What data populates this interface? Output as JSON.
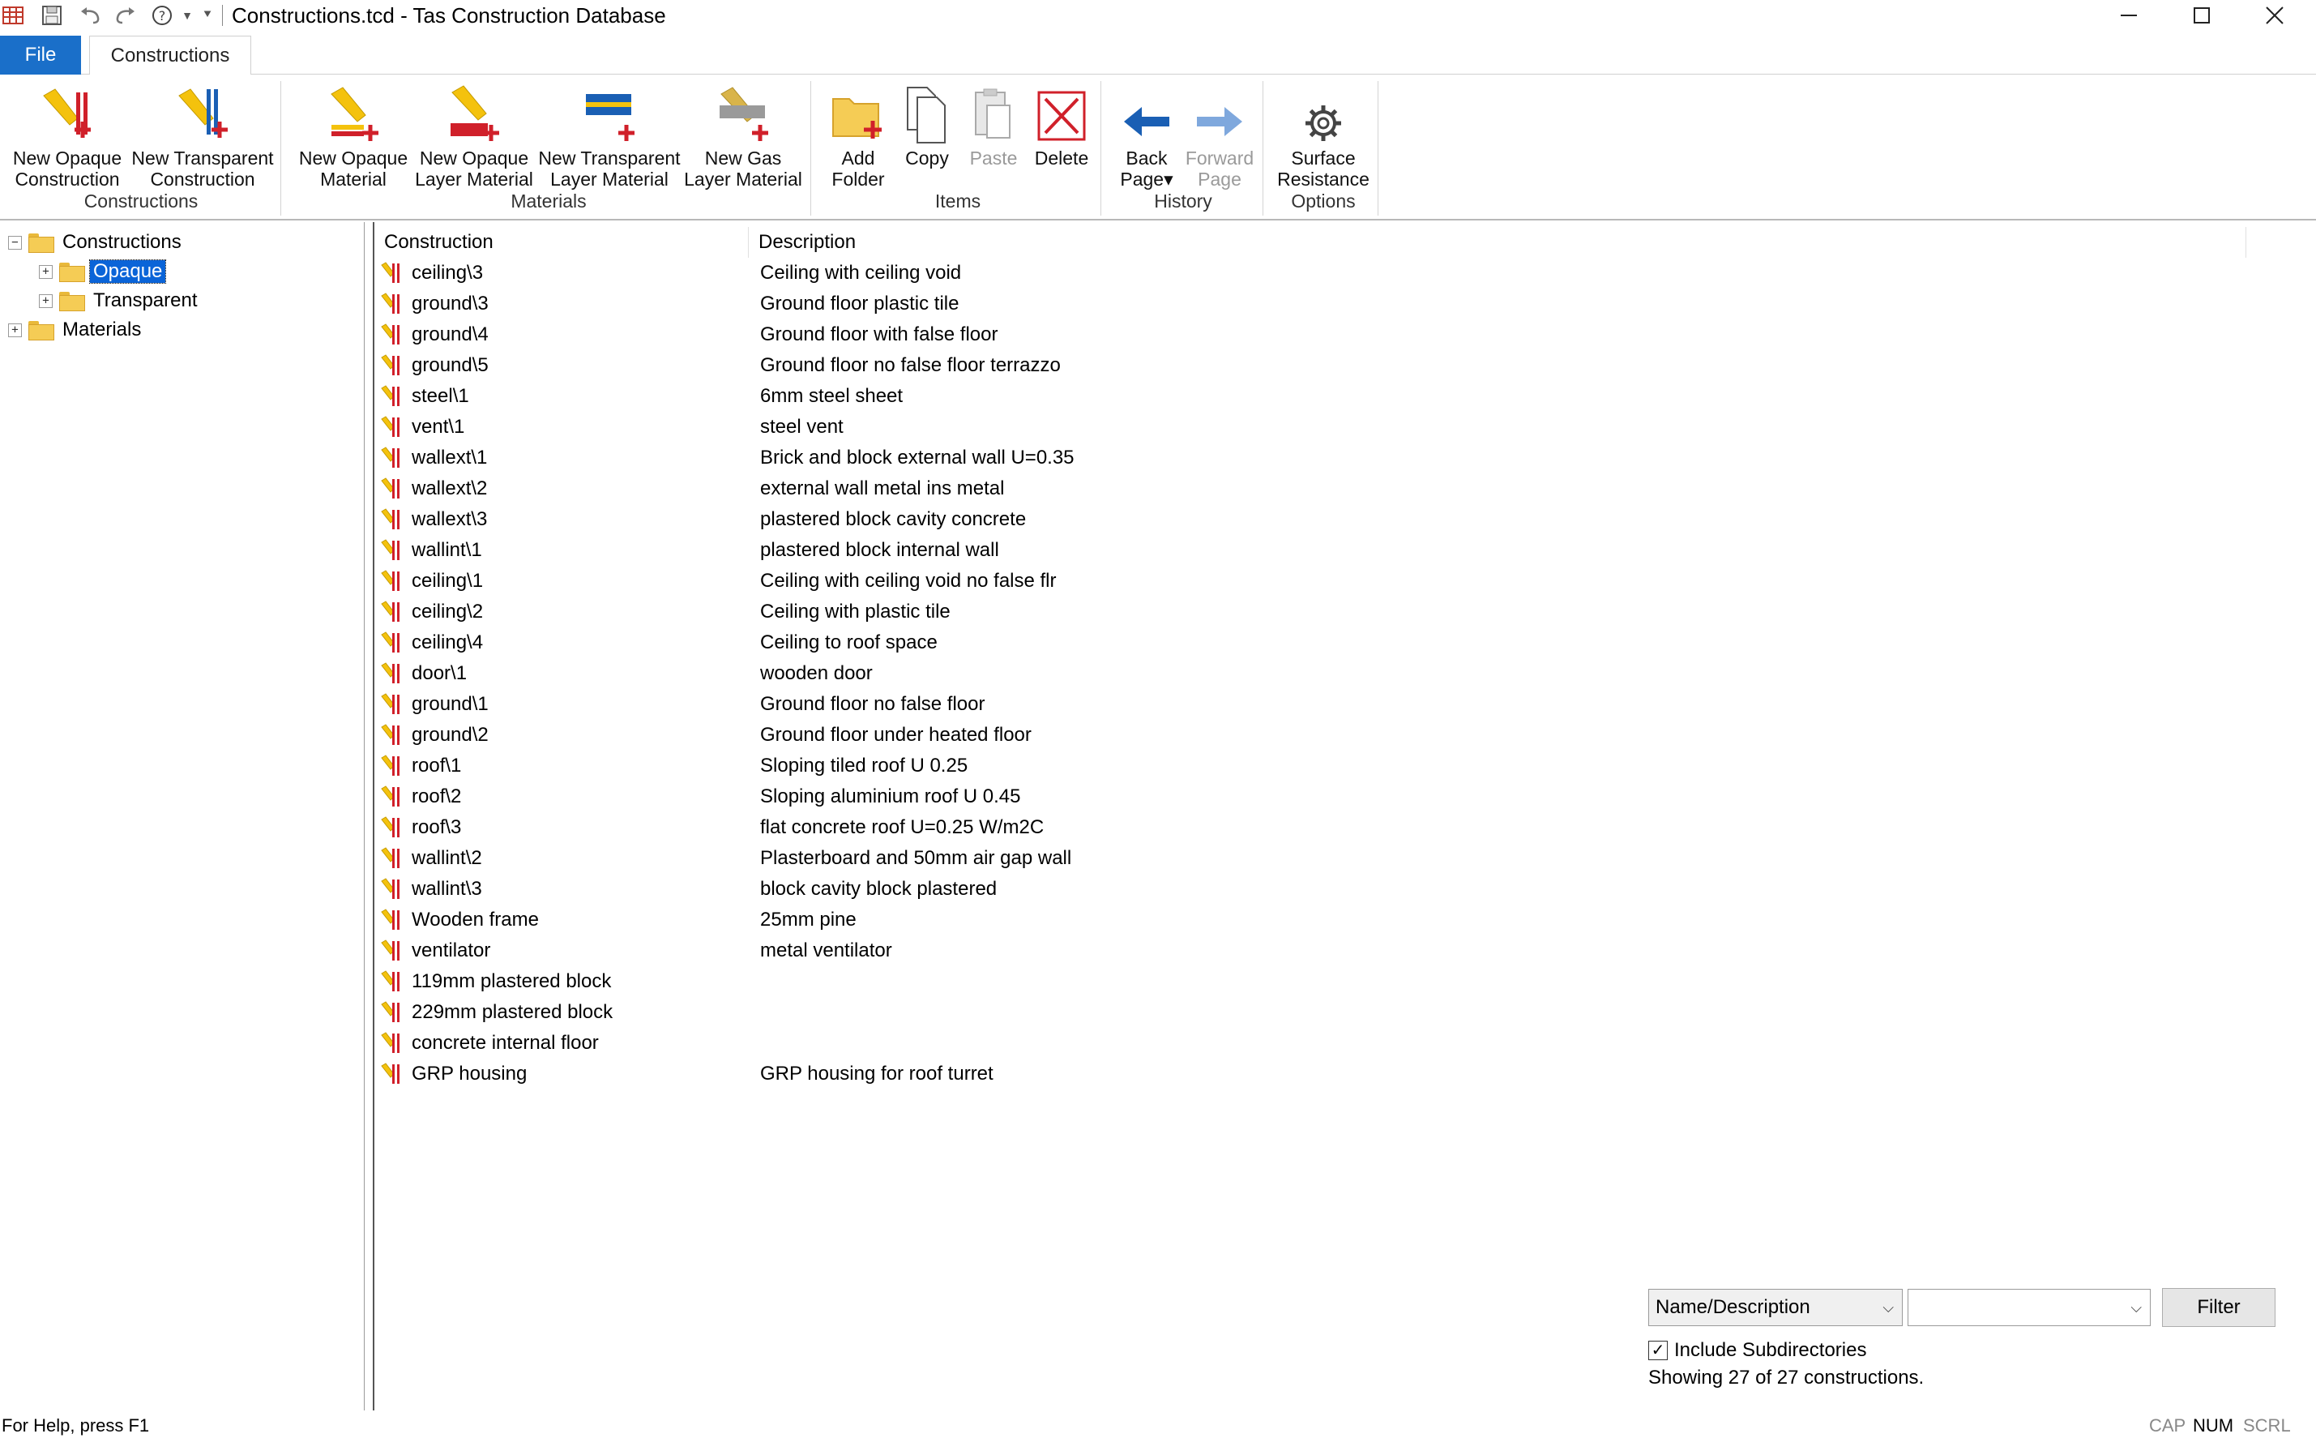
{
  "window": {
    "title": "Constructions.tcd - Tas Construction Database",
    "quick_access": [
      "save-icon",
      "undo-icon",
      "redo-icon",
      "help-icon",
      "customize-icon"
    ]
  },
  "tabs": {
    "file": "File",
    "constructions": "Constructions"
  },
  "ribbon": {
    "groups": {
      "constructions": "Constructions",
      "materials": "Materials",
      "items": "Items",
      "history": "History",
      "options": "Options"
    },
    "buttons": {
      "new_opaque_construction": [
        "New Opaque",
        "Construction"
      ],
      "new_transparent_construction": [
        "New Transparent",
        "Construction"
      ],
      "new_opaque_material": [
        "New Opaque",
        "Material"
      ],
      "new_opaque_layer_material": [
        "New Opaque",
        "Layer Material"
      ],
      "new_transparent_layer_material": [
        "New Transparent",
        "Layer Material"
      ],
      "new_gas_layer_material": [
        "New Gas",
        "Layer Material"
      ],
      "add_folder": [
        "Add",
        "Folder"
      ],
      "copy": [
        "Copy",
        ""
      ],
      "paste": [
        "Paste",
        ""
      ],
      "delete": [
        "Delete",
        ""
      ],
      "back_page": [
        "Back",
        "Page▾"
      ],
      "forward_page": [
        "Forward",
        "Page"
      ],
      "surface_resistance": [
        "Surface",
        "Resistance"
      ]
    }
  },
  "tree": {
    "root": "Constructions",
    "children": [
      "Opaque",
      "Transparent"
    ],
    "materials": "Materials",
    "selected": "Opaque"
  },
  "list": {
    "headers": {
      "construction": "Construction",
      "description": "Description"
    },
    "rows": [
      {
        "name": "ceiling\\3",
        "desc": "Ceiling with ceiling void"
      },
      {
        "name": "ground\\3",
        "desc": "Ground floor plastic tile"
      },
      {
        "name": "ground\\4",
        "desc": "Ground floor with false floor"
      },
      {
        "name": "ground\\5",
        "desc": "Ground floor no false floor terrazzo"
      },
      {
        "name": "steel\\1",
        "desc": "6mm steel sheet"
      },
      {
        "name": "vent\\1",
        "desc": "steel vent"
      },
      {
        "name": "wallext\\1",
        "desc": "Brick and block external wall U=0.35"
      },
      {
        "name": "wallext\\2",
        "desc": "external wall metal ins metal"
      },
      {
        "name": "wallext\\3",
        "desc": "plastered block cavity concrete"
      },
      {
        "name": "wallint\\1",
        "desc": "plastered block internal wall"
      },
      {
        "name": "ceiling\\1",
        "desc": "Ceiling with ceiling void no false flr"
      },
      {
        "name": "ceiling\\2",
        "desc": "Ceiling with plastic tile"
      },
      {
        "name": "ceiling\\4",
        "desc": "Ceiling to roof space"
      },
      {
        "name": "door\\1",
        "desc": "wooden door"
      },
      {
        "name": "ground\\1",
        "desc": "Ground floor no false floor"
      },
      {
        "name": "ground\\2",
        "desc": "Ground floor under heated floor"
      },
      {
        "name": "roof\\1",
        "desc": "Sloping tiled roof  U 0.25"
      },
      {
        "name": "roof\\2",
        "desc": "Sloping aluminium roof  U 0.45"
      },
      {
        "name": "roof\\3",
        "desc": "flat concrete roof  U=0.25 W/m2C"
      },
      {
        "name": "wallint\\2",
        "desc": "Plasterboard and 50mm air gap wall"
      },
      {
        "name": "wallint\\3",
        "desc": "block cavity block plastered"
      },
      {
        "name": "Wooden frame",
        "desc": "25mm pine"
      },
      {
        "name": "ventilator",
        "desc": "metal ventilator"
      },
      {
        "name": "119mm plastered block",
        "desc": ""
      },
      {
        "name": "229mm plastered block",
        "desc": ""
      },
      {
        "name": "concrete internal floor",
        "desc": ""
      },
      {
        "name": "GRP housing",
        "desc": "GRP housing for roof turret"
      }
    ]
  },
  "filter": {
    "field_select": "Name/Description",
    "value_select": "",
    "button": "Filter",
    "include_subdirs_label": "Include Subdirectories",
    "include_subdirs_checked": true,
    "showing": "Showing 27 of 27 constructions."
  },
  "status": {
    "help": "For Help, press F1",
    "indicators": [
      "CAP",
      "NUM",
      "SCRL"
    ]
  },
  "colors": {
    "accent": "#1a6fc9",
    "selection": "#0a64d8",
    "construction_icon": "#d0202a"
  }
}
